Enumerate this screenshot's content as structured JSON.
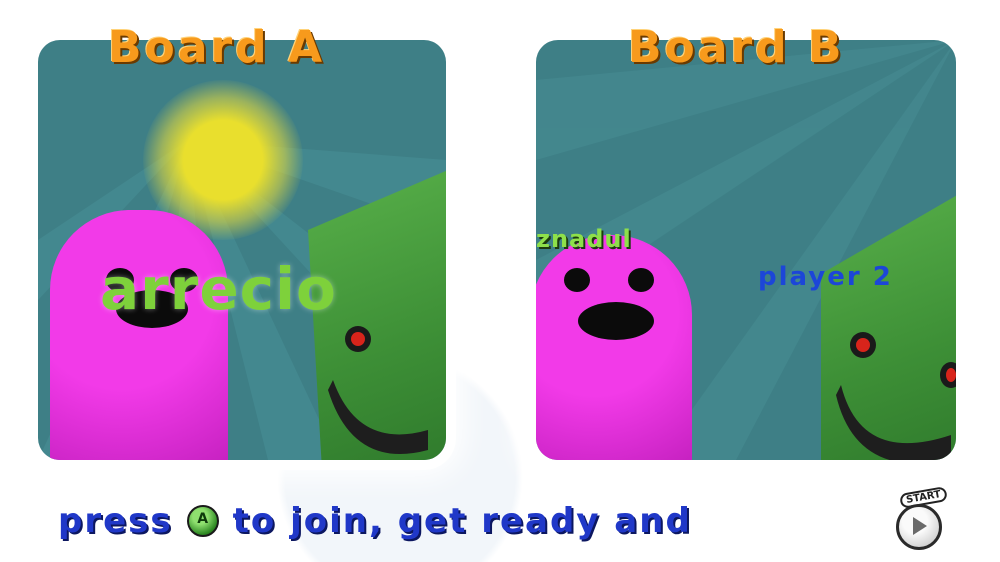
{
  "boards": [
    {
      "title": "Board A",
      "player_name": "arrecio"
    },
    {
      "title": "Board B",
      "player_name": "znadul",
      "slot_label": "player 2"
    }
  ],
  "prompt": {
    "text_before_button": "press",
    "text_after_button": "to join, get ready and",
    "button_icon": "a-button-icon",
    "start_icon": "start-button-icon",
    "start_label": "START"
  },
  "colors": {
    "title": "#f79a1c",
    "prompt_text": "#2038c8",
    "board_background": "#3e7f86",
    "player_blob": "#e12fd8",
    "monster_green": "#4aa13f",
    "player_name_a": "#7ed13b",
    "player_2_label": "#1c46d8"
  }
}
